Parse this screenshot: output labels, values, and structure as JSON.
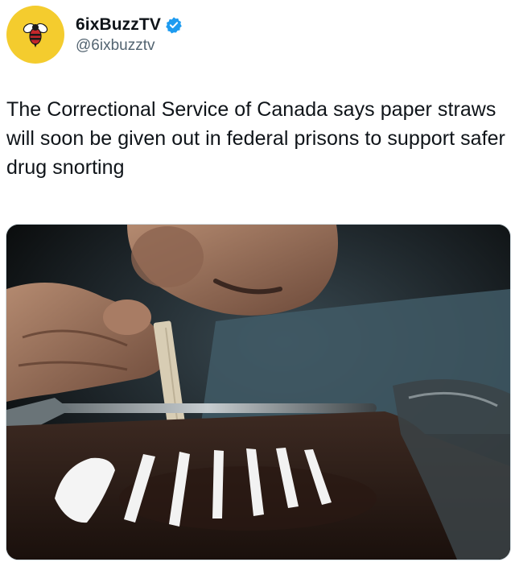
{
  "author": {
    "display_name": "6ixBuzzTV",
    "handle": "@6ixbuzztv",
    "avatar_icon": "bee-logo-icon",
    "verified_icon": "verified-badge-icon",
    "avatar_color": "#f4cc2e",
    "verified_color": "#1d9bf0"
  },
  "tweet": {
    "text": "The Correctional Service of Canada says paper straws will soon be given out in federal prisons to support safer drug snorting"
  },
  "media": {
    "kind": "photo"
  }
}
